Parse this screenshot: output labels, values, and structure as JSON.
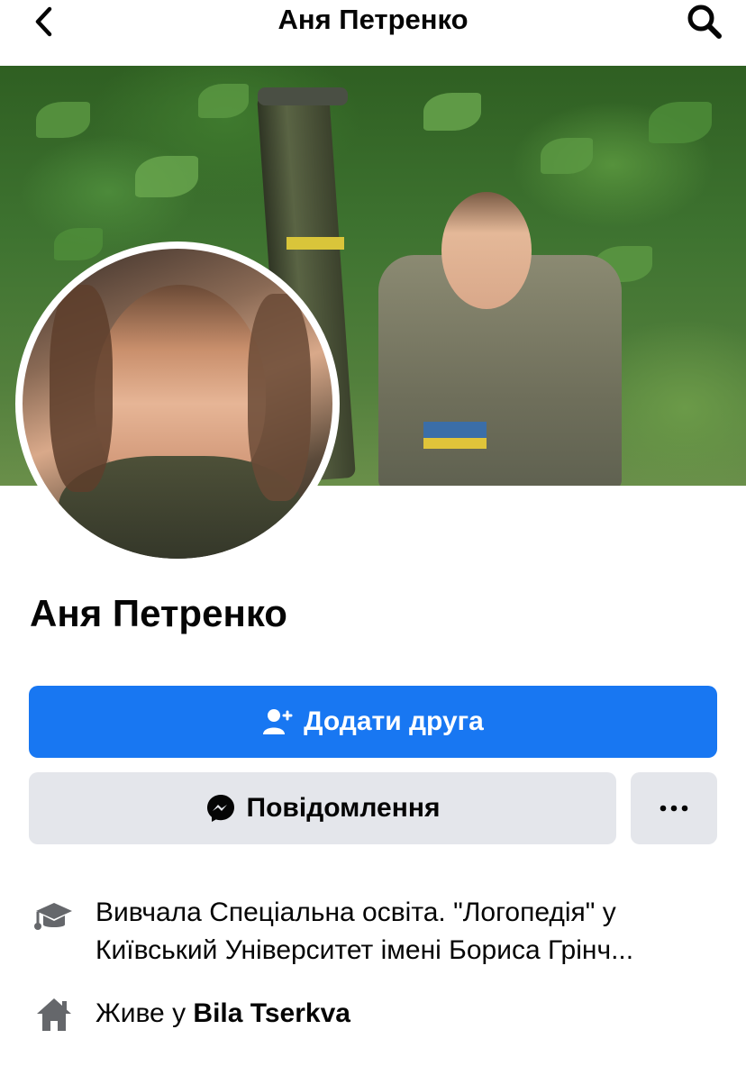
{
  "header": {
    "title": "Аня Петренко",
    "back_icon": "chevron-left-icon",
    "search_icon": "search-icon"
  },
  "profile": {
    "name": "Аня Петренко"
  },
  "actions": {
    "add_friend_label": "Додати друга",
    "message_label": "Повідомлення",
    "more_label": "···"
  },
  "intro": {
    "education_line1": "Вивчала Спеціальна освіта. \"Логопедія\"  у",
    "education_line2": "Київський Університет імені Бориса Грінч...",
    "lives_prefix": "Живе у ",
    "lives_place": "Bila Tserkva"
  },
  "colors": {
    "primary": "#1877f2",
    "secondary_button": "#e4e6eb",
    "icon_gray": "#65676b"
  }
}
